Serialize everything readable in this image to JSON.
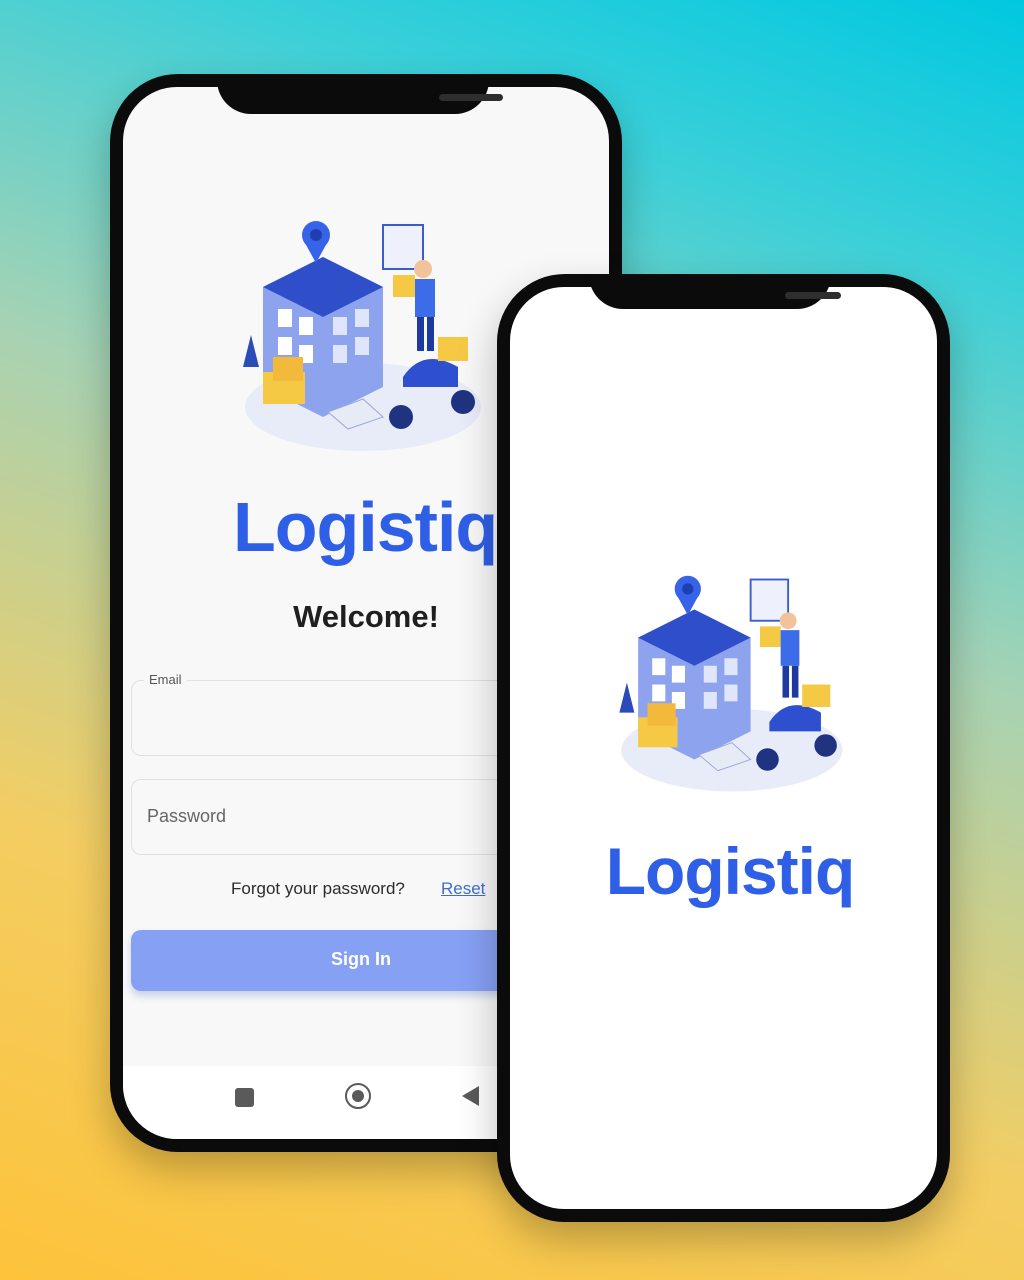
{
  "login_screen": {
    "brand": "Logistiq",
    "welcome": "Welcome!",
    "email_label": "Email",
    "email_value": "",
    "password_placeholder": "Password",
    "forgot_text": "Forgot your password?",
    "reset_link": "Reset",
    "sign_in_button": "Sign In",
    "nav_icons": [
      "square-icon",
      "home-circle-icon",
      "back-triangle-icon"
    ]
  },
  "splash_screen": {
    "brand": "Logistiq"
  },
  "colors": {
    "brand_blue": "#2f5fe6",
    "sign_in_button": "#86a0f4",
    "link": "#3d6fd0"
  }
}
